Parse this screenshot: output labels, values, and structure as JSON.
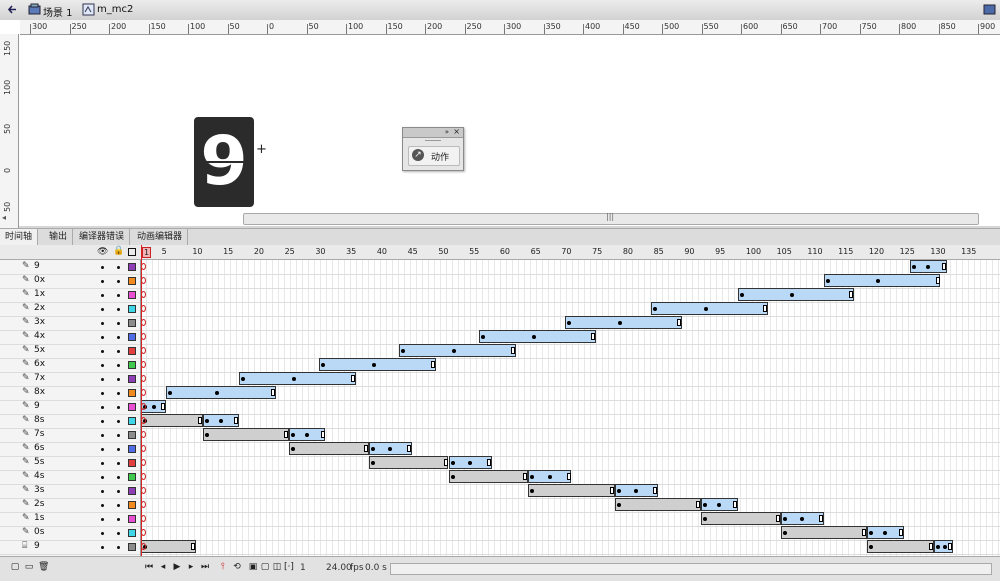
{
  "breadcrumb": {
    "scene": "场景 1",
    "symbol": "m_mc2"
  },
  "ruler": {
    "h_labels": [
      "300",
      "250",
      "200",
      "150",
      "100",
      "50",
      "0",
      "50",
      "100",
      "150",
      "200",
      "250",
      "300",
      "350",
      "400",
      "450",
      "500",
      "550",
      "600",
      "650",
      "700",
      "750",
      "800",
      "850",
      "900"
    ],
    "v_labels": [
      "150",
      "100",
      "50",
      "0",
      "50"
    ]
  },
  "stage": {
    "digit": "9",
    "crosshair": "+"
  },
  "actions_panel": {
    "label": "动作"
  },
  "tabs": [
    "时间轴",
    "输出",
    "编译器错误",
    "动画编辑器"
  ],
  "frame_numbers": [
    "1",
    "5",
    "10",
    "15",
    "20",
    "25",
    "30",
    "35",
    "40",
    "45",
    "50",
    "55",
    "60",
    "65",
    "70",
    "75",
    "80",
    "85",
    "90",
    "95",
    "100",
    "105",
    "110",
    "115",
    "120",
    "125",
    "130",
    "135"
  ],
  "layers": [
    {
      "name": "9",
      "color": "#8e3fb5",
      "icon": "layer-icon"
    },
    {
      "name": "0x",
      "color": "#ef8a1e",
      "icon": "layer-icon"
    },
    {
      "name": "1x",
      "color": "#e94fd2",
      "icon": "layer-icon"
    },
    {
      "name": "2x",
      "color": "#3fd7e8",
      "icon": "layer-icon"
    },
    {
      "name": "3x",
      "color": "#8c8c8c",
      "icon": "layer-icon"
    },
    {
      "name": "4x",
      "color": "#4f6ee6",
      "icon": "layer-icon"
    },
    {
      "name": "5x",
      "color": "#e24040",
      "icon": "layer-icon"
    },
    {
      "name": "6x",
      "color": "#3fc94f",
      "icon": "layer-icon"
    },
    {
      "name": "7x",
      "color": "#8e3fb5",
      "icon": "layer-icon"
    },
    {
      "name": "8x",
      "color": "#ef8a1e",
      "icon": "layer-icon"
    },
    {
      "name": "9",
      "color": "#e94fd2",
      "icon": "layer-icon"
    },
    {
      "name": "8s",
      "color": "#3fd7e8",
      "icon": "layer-icon"
    },
    {
      "name": "7s",
      "color": "#8c8c8c",
      "icon": "layer-icon"
    },
    {
      "name": "6s",
      "color": "#4f6ee6",
      "icon": "layer-icon"
    },
    {
      "name": "5s",
      "color": "#e24040",
      "icon": "layer-icon"
    },
    {
      "name": "4s",
      "color": "#3fc94f",
      "icon": "layer-icon"
    },
    {
      "name": "3s",
      "color": "#8e3fb5",
      "icon": "layer-icon"
    },
    {
      "name": "2s",
      "color": "#ef8a1e",
      "icon": "layer-icon"
    },
    {
      "name": "1s",
      "color": "#e94fd2",
      "icon": "layer-icon"
    },
    {
      "name": "0s",
      "color": "#3fd7e8",
      "icon": "layer-icon"
    },
    {
      "name": "9",
      "color": "#8c8c8c",
      "icon": "folder-layer-icon"
    }
  ],
  "tweens": [
    [
      {
        "start": 126,
        "end": 132,
        "type": "motion"
      }
    ],
    [
      {
        "start": 112,
        "end": 131,
        "type": "motion"
      }
    ],
    [
      {
        "start": 98,
        "end": 117,
        "type": "motion"
      }
    ],
    [
      {
        "start": 84,
        "end": 103,
        "type": "motion"
      }
    ],
    [
      {
        "start": 70,
        "end": 89,
        "type": "motion"
      }
    ],
    [
      {
        "start": 56,
        "end": 75,
        "type": "motion"
      }
    ],
    [
      {
        "start": 43,
        "end": 62,
        "type": "motion"
      }
    ],
    [
      {
        "start": 30,
        "end": 49,
        "type": "motion"
      }
    ],
    [
      {
        "start": 17,
        "end": 36,
        "type": "motion"
      }
    ],
    [
      {
        "start": 5,
        "end": 23,
        "type": "motion"
      }
    ],
    [
      {
        "start": 1,
        "end": 5,
        "type": "motion"
      }
    ],
    [
      {
        "start": 1,
        "end": 11,
        "type": "shape"
      },
      {
        "start": 11,
        "end": 17,
        "type": "motion"
      }
    ],
    [
      {
        "start": 11,
        "end": 25,
        "type": "shape"
      },
      {
        "start": 25,
        "end": 31,
        "type": "motion"
      }
    ],
    [
      {
        "start": 25,
        "end": 38,
        "type": "shape"
      },
      {
        "start": 38,
        "end": 45,
        "type": "motion"
      }
    ],
    [
      {
        "start": 38,
        "end": 51,
        "type": "shape"
      },
      {
        "start": 51,
        "end": 58,
        "type": "motion"
      }
    ],
    [
      {
        "start": 51,
        "end": 64,
        "type": "shape"
      },
      {
        "start": 64,
        "end": 71,
        "type": "motion"
      }
    ],
    [
      {
        "start": 64,
        "end": 78,
        "type": "shape"
      },
      {
        "start": 78,
        "end": 85,
        "type": "motion"
      }
    ],
    [
      {
        "start": 78,
        "end": 92,
        "type": "shape"
      },
      {
        "start": 92,
        "end": 98,
        "type": "motion"
      }
    ],
    [
      {
        "start": 92,
        "end": 105,
        "type": "shape"
      },
      {
        "start": 105,
        "end": 112,
        "type": "motion"
      }
    ],
    [
      {
        "start": 105,
        "end": 119,
        "type": "shape"
      },
      {
        "start": 119,
        "end": 125,
        "type": "motion"
      }
    ],
    [
      {
        "start": 1,
        "end": 10,
        "type": "shape"
      },
      {
        "start": 119,
        "end": 130,
        "type": "shape"
      },
      {
        "start": 130,
        "end": 133,
        "type": "motion"
      }
    ]
  ],
  "colors": {
    "motion": "#b9d9f7",
    "shape": "#cfcfcf",
    "playhead": "#d22222"
  },
  "footer": {
    "frame": "1",
    "fps": "24.00",
    "fps_unit": "fps",
    "time": "0.0 s"
  }
}
